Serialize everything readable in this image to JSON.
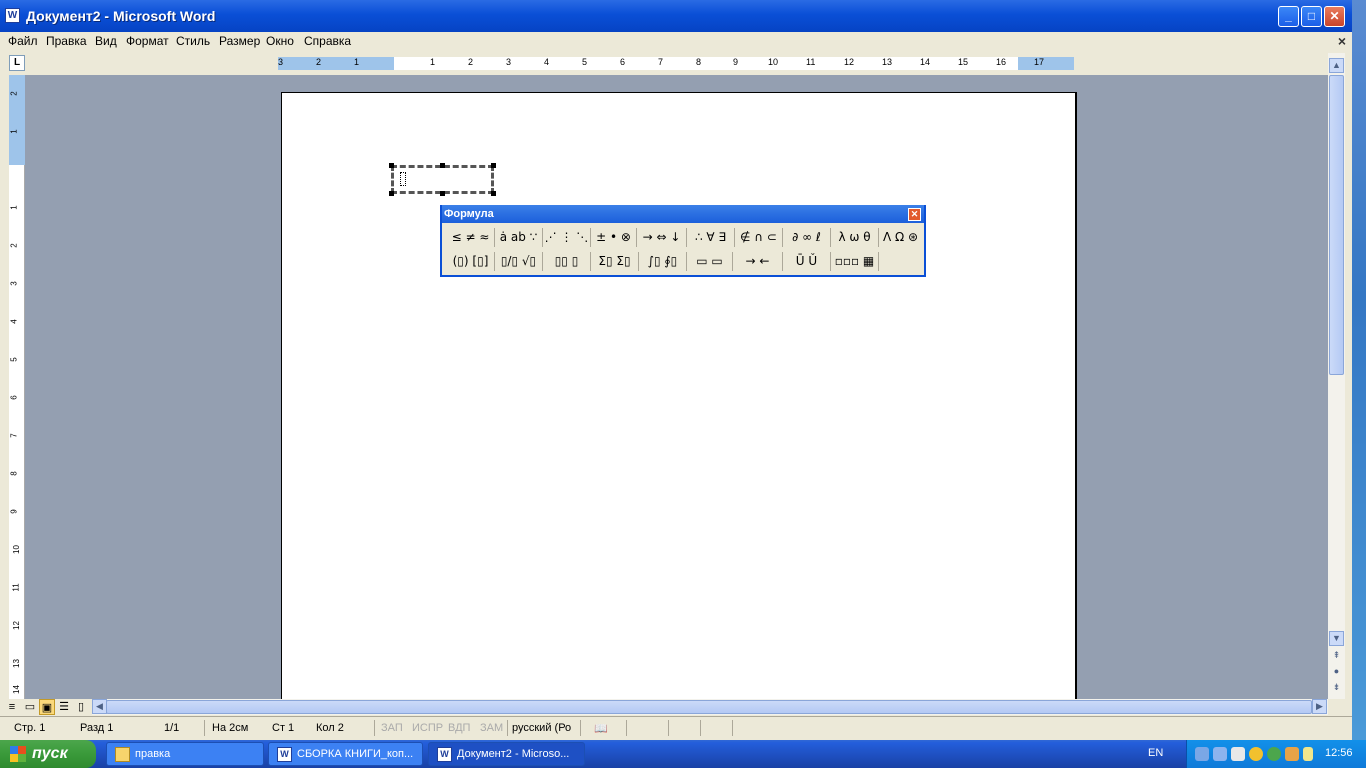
{
  "window": {
    "title": "Документ2 - Microsoft Word",
    "app_icon": "W",
    "buttons": {
      "minimize": "_",
      "maximize": "□",
      "close": "✕"
    }
  },
  "menu": {
    "items": [
      "Файл",
      "Правка",
      "Вид",
      "Формат",
      "Стиль",
      "Размер",
      "Окно",
      "Справка"
    ],
    "close_doc": "×"
  },
  "ruler": {
    "tab_selector": "L",
    "h_labels": [
      "3",
      "2",
      "1",
      "1",
      "2",
      "3",
      "4",
      "5",
      "6",
      "7",
      "8",
      "9",
      "10",
      "11",
      "12",
      "13",
      "14",
      "15",
      "16",
      "17"
    ],
    "v_labels": [
      "2",
      "1",
      "1",
      "2",
      "3",
      "4",
      "5",
      "6",
      "7",
      "8",
      "9",
      "10",
      "11",
      "12",
      "13",
      "14"
    ]
  },
  "formula_toolbar": {
    "title": "Формула",
    "row1": [
      "≤ ≠ ≈",
      "ȧ ab ∵",
      "⋰ ⋮ ⋱",
      "± • ⊗",
      "→ ⇔ ↓",
      "∴ ∀ ∃",
      "∉ ∩ ⊂",
      "∂ ∞ ℓ",
      "λ ω θ",
      "Λ Ω ⊛"
    ],
    "row2": [
      "(▯) [▯]",
      "▯/▯ √▯",
      "▯▯ ▯",
      "Σ▯ Σ▯",
      "∫▯ ∮▯",
      "▭ ▭",
      "→ ←",
      "Ū Ǔ",
      "▫▫▫ ▦"
    ]
  },
  "status": {
    "page": "Стр. 1",
    "section": "Разд 1",
    "pages": "1/1",
    "at": "На 2см",
    "line": "Ст 1",
    "col": "Кол 2",
    "rec": "ЗАП",
    "trk": "ИСПР",
    "ext": "ВДП",
    "ovr": "ЗАМ",
    "lang": "русский (Ро"
  },
  "taskbar": {
    "start": "пуск",
    "items": [
      {
        "label": "правка",
        "icon": "folder-icon"
      },
      {
        "label": "СБОРКА КНИГИ_коп...",
        "icon": "word-icon"
      },
      {
        "label": "Документ2 - Microso...",
        "icon": "word-icon"
      }
    ],
    "lang": "EN",
    "clock": "12:56"
  }
}
